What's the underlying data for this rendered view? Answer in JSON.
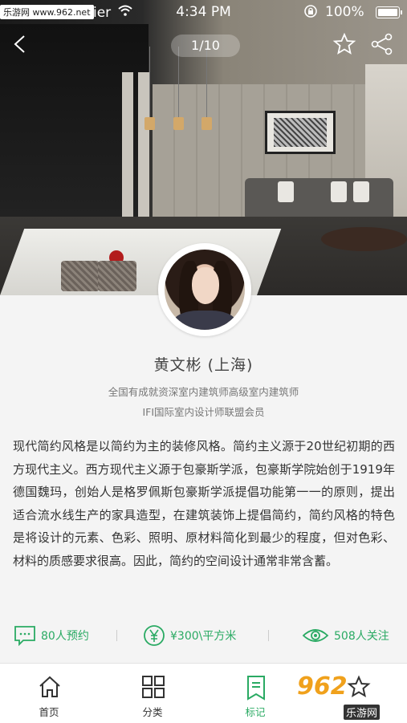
{
  "watermark_top": "乐游网 www.962.net",
  "status_bar": {
    "carrier": "Carrier",
    "wifi_icon": "wifi-icon",
    "time": "4:34 PM",
    "lock_icon": "rotation-lock-icon",
    "battery_pct": "100%"
  },
  "nav": {
    "back_icon": "chevron-left-icon",
    "pager": "1/10",
    "star_icon": "star-outline-icon",
    "share_icon": "share-icon"
  },
  "profile": {
    "name": "黄文彬 (上海)",
    "subtitle_1": "全国有成就资深室内建筑师高级室内建筑师",
    "subtitle_2": "IFI国际室内设计师联盟会员",
    "bio": "现代简约风格是以简约为主的装修风格。简约主义源于20世纪初期的西方现代主义。西方现代主义源于包豪斯学派，包豪斯学院始创于1919年德国魏玛，创始人是格罗佩斯包豪斯学派提倡功能第一一的原则，提出适合流水线生产的家具造型，在建筑装饰上提倡简约，简约风格的特色是将设计的元素、色彩、照明、原材料简化到最少的程度，但对色彩、材料的质感要求很高。因此，简约的空间设计通常非常含蓄。"
  },
  "stats": {
    "appointments": "80人预约",
    "price": "¥300\\平方米",
    "followers": "508人关注"
  },
  "tabs": [
    {
      "label": "首页",
      "icon": "home-icon"
    },
    {
      "label": "分类",
      "icon": "grid-icon"
    },
    {
      "label": "标记",
      "icon": "bookmark-icon"
    },
    {
      "label": "",
      "icon": "star-icon"
    }
  ],
  "watermark_br": {
    "logo": "962",
    "text": "乐游网"
  },
  "colors": {
    "accent": "#2aaa63",
    "text": "#333333",
    "muted": "#777777",
    "background": "#f4f4f4"
  }
}
